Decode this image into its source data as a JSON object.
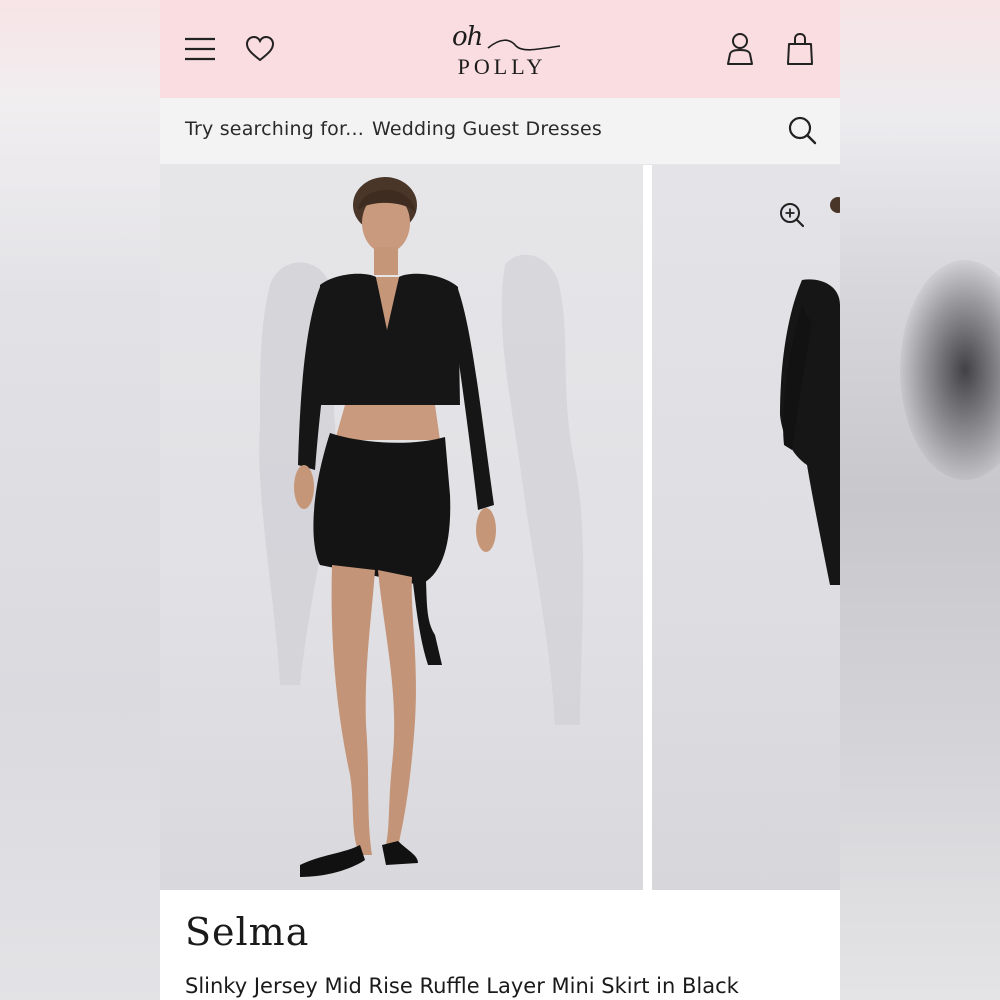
{
  "header": {
    "logo_top": "oh",
    "logo_bottom": "POLLY",
    "icons": {
      "menu": "hamburger-menu-icon",
      "wishlist": "heart-icon",
      "account": "user-icon",
      "bag": "shopping-bag-icon"
    },
    "background": "#fadde0"
  },
  "search": {
    "prompt": "Try searching for...",
    "suggestion": "Wedding Guest Dresses",
    "icon": "search-icon"
  },
  "gallery": {
    "zoom_icon": "zoom-in-icon",
    "images": [
      {
        "description_icon": "product-photo-front"
      },
      {
        "description_icon": "product-photo-side"
      }
    ]
  },
  "product": {
    "name": "Selma",
    "description": "Slinky Jersey Mid Rise Ruffle Layer Mini Skirt in Black"
  }
}
